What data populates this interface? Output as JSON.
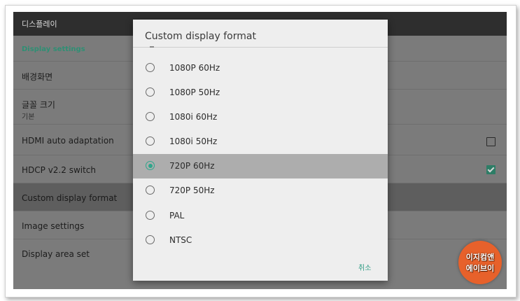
{
  "app": {
    "title": "디스플레이"
  },
  "settings": {
    "section_header": "Display settings",
    "items": [
      {
        "label": "배경화면"
      },
      {
        "label": "글꼴 크기",
        "sub": "기본"
      },
      {
        "label": "HDMI auto adaptation",
        "checked": false
      },
      {
        "label": "HDCP v2.2 switch",
        "checked": true
      },
      {
        "label": "Custom display format"
      },
      {
        "label": "Image settings"
      },
      {
        "label": "Display area set"
      }
    ]
  },
  "dialog": {
    "title": "Custom display format",
    "options": [
      {
        "label": "1080P 60Hz",
        "selected": false
      },
      {
        "label": "1080P 50Hz",
        "selected": false
      },
      {
        "label": "1080i 60Hz",
        "selected": false
      },
      {
        "label": "1080i 50Hz",
        "selected": false
      },
      {
        "label": "720P 60Hz",
        "selected": true
      },
      {
        "label": "720P 50Hz",
        "selected": false
      },
      {
        "label": "PAL",
        "selected": false
      },
      {
        "label": "NTSC",
        "selected": false
      }
    ],
    "cancel_label": "취소"
  },
  "watermark": {
    "line1": "이지컴앤",
    "line2": "에이브이"
  },
  "colors": {
    "accent": "#2fa58b",
    "badge": "#e7612b"
  }
}
